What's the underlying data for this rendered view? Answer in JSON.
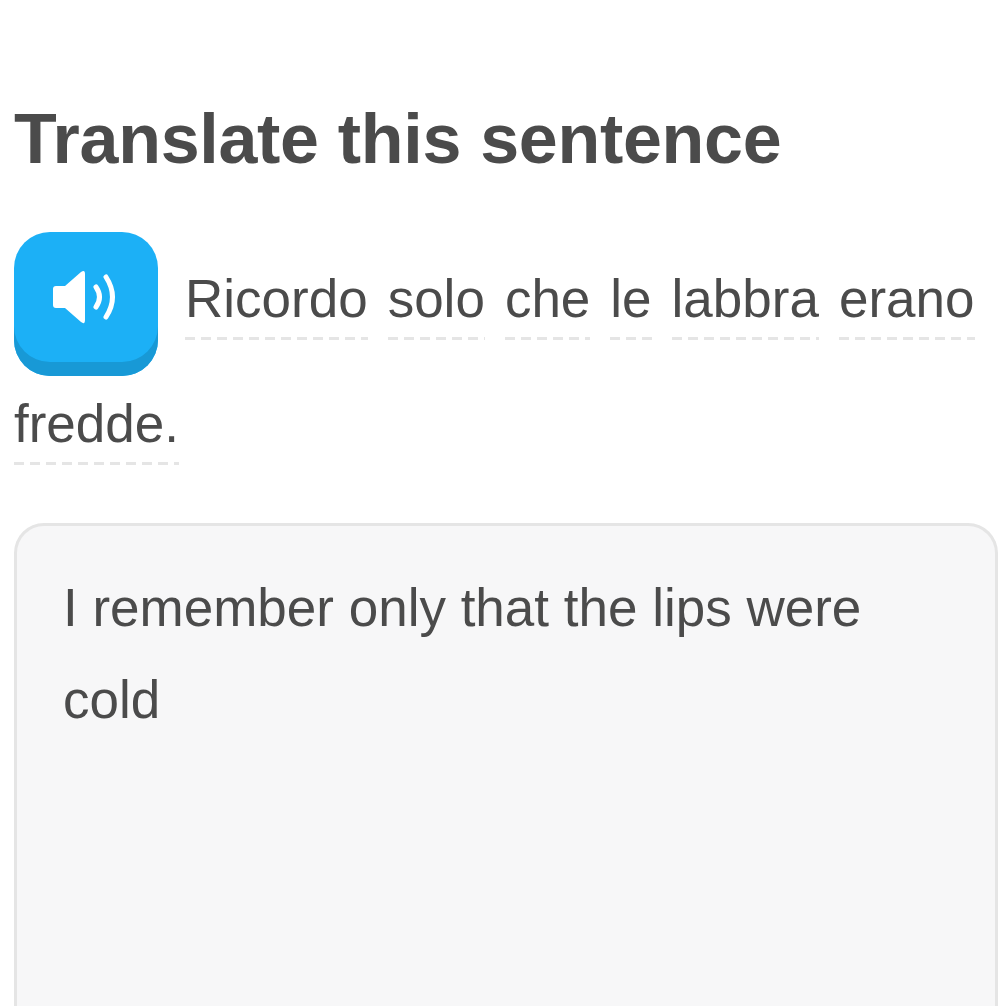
{
  "heading": "Translate this sentence",
  "prompt": {
    "words": [
      "Ricordo",
      "solo",
      "che",
      "le",
      "labbra",
      "erano",
      "fredde."
    ]
  },
  "answer": {
    "value": "I remember only that the lips were cold"
  }
}
